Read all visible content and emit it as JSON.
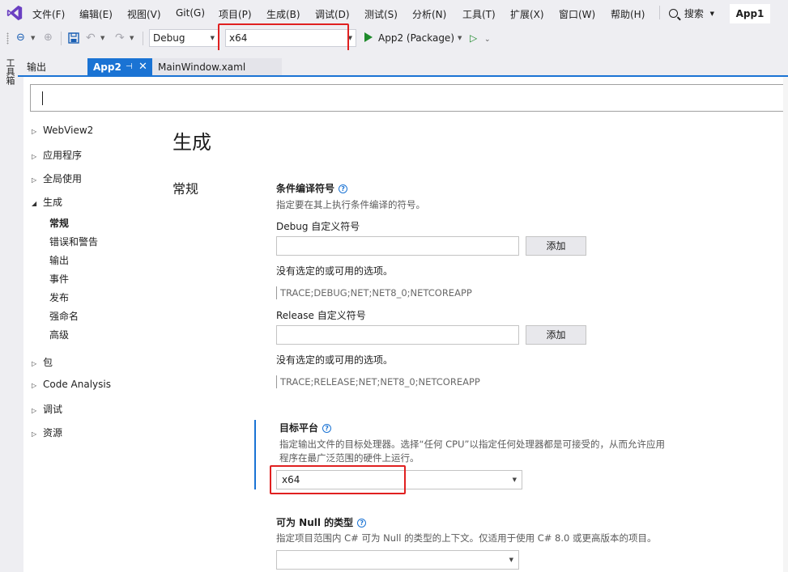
{
  "menu": {
    "items": [
      "文件(F)",
      "编辑(E)",
      "视图(V)",
      "Git(G)",
      "项目(P)",
      "生成(B)",
      "调试(D)",
      "测试(S)",
      "分析(N)",
      "工具(T)",
      "扩展(X)",
      "窗口(W)",
      "帮助(H)"
    ],
    "search_label": "搜索",
    "app_name": "App1"
  },
  "toolbar": {
    "configuration": "Debug",
    "platform": "x64",
    "run_target": "App2 (Package)"
  },
  "side_strip": {
    "label": "工具箱"
  },
  "tabs": {
    "output": "输出",
    "active": "App2",
    "pin_glyph": "⊣",
    "close_glyph": "✕",
    "xaml": "MainWindow.xaml"
  },
  "nav": {
    "webview2": "WebView2",
    "application": "应用程序",
    "global_usings": "全局使用",
    "build": "生成",
    "build_children": [
      "常规",
      "错误和警告",
      "输出",
      "事件",
      "发布",
      "强命名",
      "高级"
    ],
    "package": "包",
    "code_analysis": "Code Analysis",
    "debug": "调试",
    "resources": "资源"
  },
  "page": {
    "heading": "生成",
    "section": "常规"
  },
  "conditional_symbols": {
    "title": "条件编译符号",
    "description": "指定要在其上执行条件编译的符号。",
    "debug_label": "Debug 自定义符号",
    "add_button": "添加",
    "empty_note": "没有选定的或可用的选项。",
    "debug_value": "TRACE;DEBUG;NET;NET8_0;NETCOREAPP",
    "release_label": "Release 自定义符号",
    "release_value": "TRACE;RELEASE;NET;NET8_0;NETCOREAPP"
  },
  "platform_target": {
    "title": "目标平台",
    "description_1": "指定输出文件的目标处理器。选择“任何 CPU”以指定任何处理器都是可接受的，从而允许应用",
    "description_2": "程序在最广泛范围的硬件上运行。",
    "value": "x64"
  },
  "nullable": {
    "title": "可为 Null 的类型",
    "description": "指定项目范围内 C# 可为 Null 的类型的上下文。仅适用于使用 C# 8.0 或更高版本的项目。",
    "value": ""
  },
  "colors": {
    "accent": "#1a73d4",
    "highlight_box": "#e02020",
    "run_green": "#1e8a2b"
  }
}
